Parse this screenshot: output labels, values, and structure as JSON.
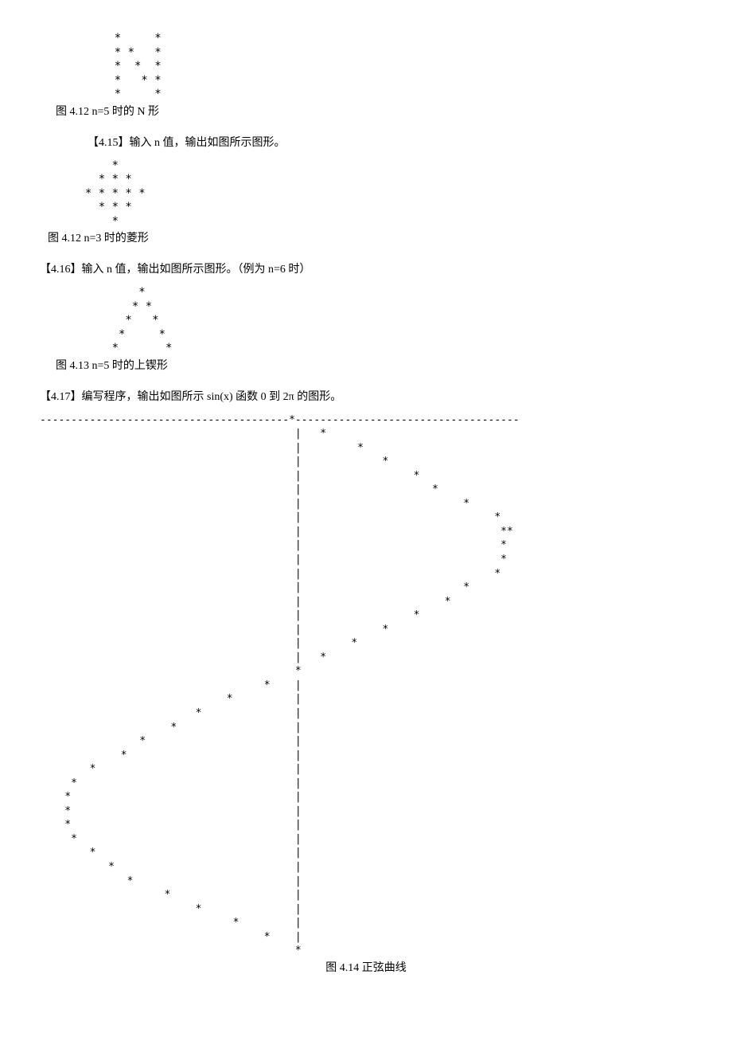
{
  "p414": {
    "pattern": "    *     *\n    * *   *\n    *  *  *\n    *   * *\n    *     *",
    "caption": "图 4.12 n=5 时的 N 形"
  },
  "p415": {
    "prompt": "【4.15】输入 n 值，输出如图所示图形。",
    "pattern": "      *\n    * * *\n  * * * * *\n    * * *\n      *",
    "caption": "图 4.12 n=3 时的菱形"
  },
  "p416": {
    "prompt": "【4.16】输入 n 值，输出如图所示图形。（例为 n=6 时）",
    "pattern": "          *\n         * *\n        *   *\n       *     *\n      *       *",
    "caption": "图 4.13 n=5 时的上锲形"
  },
  "p417": {
    "prompt": "【4.17】编写程序，输出如图所示 sin(x) 函数 0 到 2π 的图形。",
    "pattern": "----------------------------------------*------------------------------------\n                                         |   *\n                                         |         *\n                                         |             *\n                                         |                  *\n                                         |                     *\n                                         |                          *\n                                         |                               *\n                                         |                                **\n                                         |                                *\n                                         |                                *\n                                         |                               *\n                                         |                          *\n                                         |                       *\n                                         |                  *\n                                         |             *\n                                         |        *\n                                         |   *\n                                         *\n                                    *    |\n                              *          |\n                         *               |\n                     *                   |\n                *                        |\n             *                           |\n        *                                |\n     *                                   |\n    *                                    |\n    *                                    |\n    *                                    |\n     *                                   |\n        *                                |\n           *                             |\n              *                          |\n                    *                    |\n                         *               |\n                               *         |\n                                    *    |\n                                         *",
    "caption": "图 4.14  正弦曲线"
  }
}
